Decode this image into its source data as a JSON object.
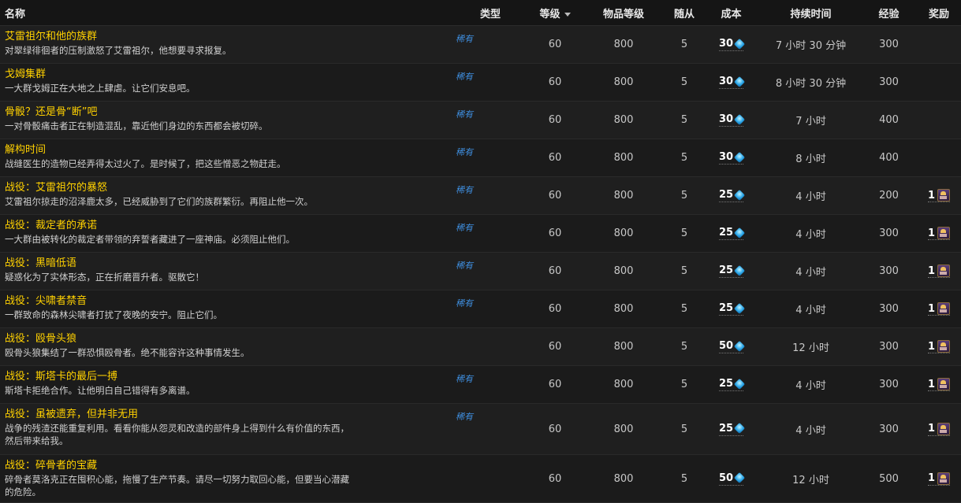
{
  "headers": {
    "name": "名称",
    "type": "类型",
    "level": "等级",
    "item_level": "物品等级",
    "followers": "随从",
    "cost": "成本",
    "duration": "持续时间",
    "xp": "经验",
    "reward": "奖励"
  },
  "rows": [
    {
      "title": "艾雷祖尔和他的族群",
      "desc": "对翠绿徘徊者的压制激怒了艾雷祖尔，他想要寻求报复。",
      "type": "稀有",
      "level": "60",
      "item_level": "800",
      "followers": "5",
      "cost": "30",
      "duration": "7 小时 30 分钟",
      "xp": "300",
      "reward": ""
    },
    {
      "title": "戈姆集群",
      "desc": "一大群戈姆正在大地之上肆虐。让它们安息吧。",
      "type": "稀有",
      "level": "60",
      "item_level": "800",
      "followers": "5",
      "cost": "30",
      "duration": "8 小时 30 分钟",
      "xp": "300",
      "reward": ""
    },
    {
      "title": "骨骰？还是骨“断”吧",
      "desc": "一对骨骰痛击者正在制造混乱，靠近他们身边的东西都会被切碎。",
      "type": "稀有",
      "level": "60",
      "item_level": "800",
      "followers": "5",
      "cost": "30",
      "duration": "7 小时",
      "xp": "400",
      "reward": ""
    },
    {
      "title": "解构时间",
      "desc": "战缝医生的造物已经弄得太过火了。是时候了，把这些憎恶之物赶走。",
      "type": "稀有",
      "level": "60",
      "item_level": "800",
      "followers": "5",
      "cost": "30",
      "duration": "8 小时",
      "xp": "400",
      "reward": ""
    },
    {
      "title": "战役：艾雷祖尔的暴怒",
      "desc": "艾雷祖尔掠走的沼泽鹿太多，已经威胁到了它们的族群繁衍。再阻止他一次。",
      "type": "稀有",
      "level": "60",
      "item_level": "800",
      "followers": "5",
      "cost": "25",
      "duration": "4 小时",
      "xp": "200",
      "reward": "1"
    },
    {
      "title": "战役：裁定者的承诺",
      "desc": "一大群由被转化的裁定者带领的弃誓者藏进了一座神庙。必须阻止他们。",
      "type": "稀有",
      "level": "60",
      "item_level": "800",
      "followers": "5",
      "cost": "25",
      "duration": "4 小时",
      "xp": "300",
      "reward": "1"
    },
    {
      "title": "战役：黑暗低语",
      "desc": "疑惑化为了实体形态，正在折磨晋升者。驱散它！",
      "type": "稀有",
      "level": "60",
      "item_level": "800",
      "followers": "5",
      "cost": "25",
      "duration": "4 小时",
      "xp": "300",
      "reward": "1"
    },
    {
      "title": "战役：尖啸者禁音",
      "desc": "一群致命的森林尖啸者打扰了夜晚的安宁。阻止它们。",
      "type": "稀有",
      "level": "60",
      "item_level": "800",
      "followers": "5",
      "cost": "25",
      "duration": "4 小时",
      "xp": "300",
      "reward": "1"
    },
    {
      "title": "战役：殴骨头狼",
      "desc": "殴骨头狼集结了一群恐惧殴骨者。绝不能容许这种事情发生。",
      "type": "",
      "level": "60",
      "item_level": "800",
      "followers": "5",
      "cost": "50",
      "duration": "12 小时",
      "xp": "300",
      "reward": "1"
    },
    {
      "title": "战役：斯塔卡的最后一搏",
      "desc": "斯塔卡拒绝合作。让他明白自己错得有多离谱。",
      "type": "稀有",
      "level": "60",
      "item_level": "800",
      "followers": "5",
      "cost": "25",
      "duration": "4 小时",
      "xp": "300",
      "reward": "1"
    },
    {
      "title": "战役：虽被遗弃，但并非无用",
      "desc": "战争的残渣还能重复利用。看看你能从怨灵和改造的部件身上得到什么有价值的东西，然后带来给我。",
      "type": "稀有",
      "level": "60",
      "item_level": "800",
      "followers": "5",
      "cost": "25",
      "duration": "4 小时",
      "xp": "300",
      "reward": "1"
    },
    {
      "title": "战役：碎骨者的宝藏",
      "desc": "碎骨者莫洛克正在囤积心能，拖慢了生产节奏。请尽一切努力取回心能，但要当心潜藏的危险。",
      "type": "",
      "level": "60",
      "item_level": "800",
      "followers": "5",
      "cost": "50",
      "duration": "12 小时",
      "xp": "500",
      "reward": "1"
    }
  ],
  "icons": {
    "cost": "anima-crystal-icon",
    "reward": "reward-chest-icon"
  },
  "colors": {
    "title": "#ffd100",
    "rare": "#3f8fe0",
    "background": "#1a1a1a"
  }
}
